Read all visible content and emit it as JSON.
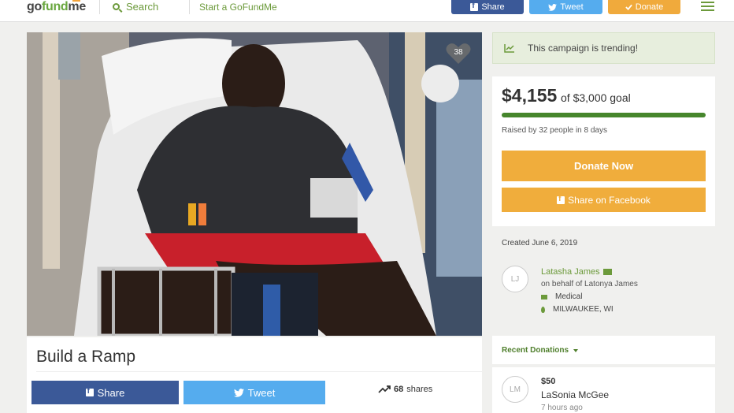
{
  "header": {
    "logo_text_prefix": "go",
    "logo_text_accent": "fund",
    "logo_text_suffix": "me",
    "search_label": "Search",
    "start_label": "Start a GoFundMe",
    "share_label": "Share",
    "tweet_label": "Tweet",
    "donate_label": "Donate"
  },
  "campaign": {
    "heart_count": "38",
    "title": "Build a Ramp",
    "share_label": "Share",
    "tweet_label": "Tweet",
    "shares_count": "68",
    "shares_suffix": "shares"
  },
  "sidebar": {
    "trending_text": "This campaign is trending!",
    "amount_raised": "$4,155",
    "goal_text": "of $3,000 goal",
    "progress_fraction": 1.0,
    "raised_text": "Raised by 32 people in 8 days",
    "donate_now_label": "Donate Now",
    "share_facebook_label": "Share on Facebook",
    "created_text": "Created June 6, 2019",
    "organizer": {
      "initials": "LJ",
      "name": "Latasha James",
      "behalf": "on behalf of Latonya James",
      "category": "Medical",
      "location": "MILWAUKEE, WI"
    },
    "recent_donations_label": "Recent Donations",
    "donation": {
      "initials": "LM",
      "amount": "$50",
      "name": "LaSonia McGee",
      "time": "7 hours ago"
    }
  },
  "colors": {
    "brand_green": "#6c9a3b",
    "progress_green": "#46862c",
    "donate_orange": "#f0ad3c",
    "facebook_blue": "#3b5998",
    "twitter_blue": "#55acee"
  }
}
